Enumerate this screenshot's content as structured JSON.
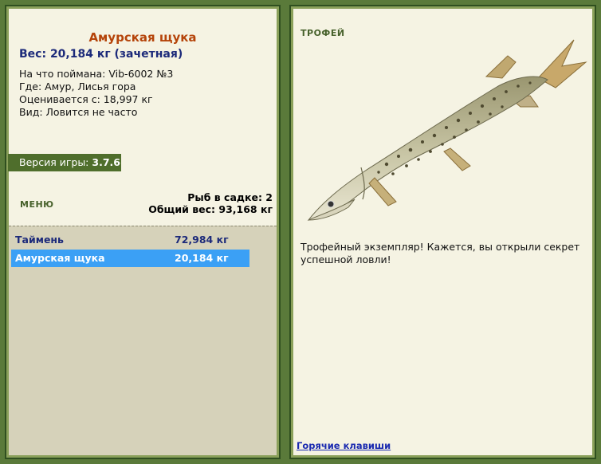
{
  "catch": {
    "fish_name": "Амурская щука",
    "weight_line": "Вес: 20,184 кг (зачетная)",
    "bait": "На что поймана: Vib-6002 №3",
    "location": "Где: Амур, Лисья гора",
    "valued_from": "Оценивается с: 18,997 кг",
    "frequency": "Вид: Ловится не часто"
  },
  "version": {
    "label": "Версия игры:",
    "value": "3.7.6"
  },
  "menu": {
    "label": "МЕНЮ"
  },
  "keepnet": {
    "count_line": "Рыб в садке: 2",
    "total_line": "Общий вес: 93,168 кг",
    "rows": [
      {
        "name": "Таймень",
        "weight": "72,984 кг",
        "selected": false
      },
      {
        "name": "Амурская щука",
        "weight": "20,184 кг",
        "selected": true
      }
    ]
  },
  "trophy": {
    "label": "ТРОФЕЙ",
    "text": "Трофейный экземпляр! Кажется, вы открыли секрет успешной ловли!"
  },
  "hotkeys": {
    "label": "Горячие клавиши"
  },
  "colors": {
    "frame": "#5a7a3a",
    "panel": "#f5f3e3",
    "title_orange": "#b5440a",
    "navy": "#1c2a7a",
    "selected_row": "#3ba0f5"
  }
}
